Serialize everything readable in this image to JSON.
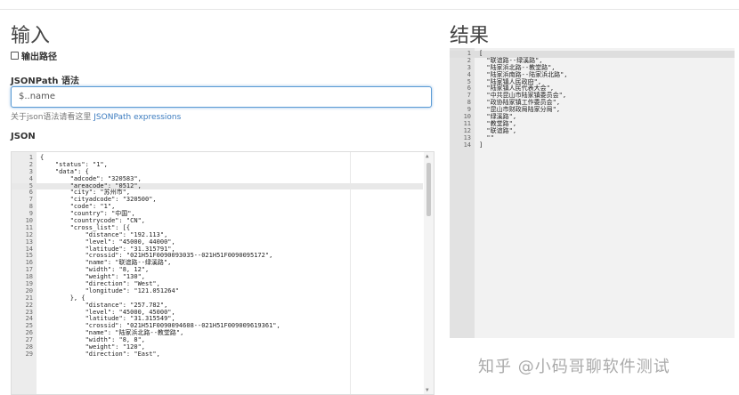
{
  "left": {
    "title": "输入",
    "output_path_label": "输出路径",
    "jsonpath_label": "JSONPath 语法",
    "jsonpath_value": "$..name",
    "help_text": "关于json语法请看这里 ",
    "help_link": "JSONPath expressions",
    "json_label": "JSON"
  },
  "editor": {
    "lines": [
      {
        "n": "1",
        "t": "{"
      },
      {
        "n": "2",
        "t": "    \"status\": \"1\","
      },
      {
        "n": "3",
        "t": "    \"data\": {"
      },
      {
        "n": "4",
        "t": "        \"adcode\": \"320583\","
      },
      {
        "n": "5",
        "t": "        \"areacode\": \"0512\","
      },
      {
        "n": "6",
        "t": "        \"city\": \"苏州市\","
      },
      {
        "n": "7",
        "t": "        \"cityadcode\": \"320500\","
      },
      {
        "n": "8",
        "t": "        \"code\": \"1\","
      },
      {
        "n": "9",
        "t": "        \"country\": \"中国\","
      },
      {
        "n": "10",
        "t": "        \"countrycode\": \"CN\","
      },
      {
        "n": "11",
        "t": "        \"cross_list\": [{"
      },
      {
        "n": "12",
        "t": "            \"distance\": \"192.113\","
      },
      {
        "n": "13",
        "t": "            \"level\": \"45000, 44000\","
      },
      {
        "n": "14",
        "t": "            \"latitude\": \"31.315791\","
      },
      {
        "n": "15",
        "t": "            \"crossid\": \"021H51F0090093035--021H51F0090095172\","
      },
      {
        "n": "16",
        "t": "            \"name\": \"联谊路--绿溪路\","
      },
      {
        "n": "17",
        "t": "            \"width\": \"8, 12\","
      },
      {
        "n": "18",
        "t": "            \"weight\": \"130\","
      },
      {
        "n": "19",
        "t": "            \"direction\": \"West\","
      },
      {
        "n": "20",
        "t": "            \"longitude\": \"121.051264\""
      },
      {
        "n": "21",
        "t": "        }, {"
      },
      {
        "n": "22",
        "t": "            \"distance\": \"257.782\","
      },
      {
        "n": "23",
        "t": "            \"level\": \"45000, 45000\","
      },
      {
        "n": "24",
        "t": "            \"latitude\": \"31.315549\","
      },
      {
        "n": "25",
        "t": "            \"crossid\": \"021H51F0090094608--021H51F009009619361\","
      },
      {
        "n": "26",
        "t": "            \"name\": \"陆家浜北路--教堂路\","
      },
      {
        "n": "27",
        "t": "            \"width\": \"8, 8\","
      },
      {
        "n": "28",
        "t": "            \"weight\": \"120\","
      },
      {
        "n": "29",
        "t": "            \"direction\": \"East\","
      }
    ]
  },
  "right": {
    "title": "结果",
    "lines": [
      {
        "n": "1",
        "t": "["
      },
      {
        "n": "2",
        "t": "  \"联谊路--绿溪路\","
      },
      {
        "n": "3",
        "t": "  \"陆家浜北路--教堂路\","
      },
      {
        "n": "4",
        "t": "  \"陆家浜南路--陆家浜北路\","
      },
      {
        "n": "5",
        "t": "  \"陆家镇人民政府\","
      },
      {
        "n": "6",
        "t": "  \"陆家镇人民代表大会\","
      },
      {
        "n": "7",
        "t": "  \"中共昆山市陆家镇委员会\","
      },
      {
        "n": "8",
        "t": "  \"政协陆家镇工作委员会\","
      },
      {
        "n": "9",
        "t": "  \"昆山市财政局陆家分局\","
      },
      {
        "n": "10",
        "t": "  \"绿溪路\","
      },
      {
        "n": "11",
        "t": "  \"教堂路\","
      },
      {
        "n": "12",
        "t": "  \"联谊路\","
      },
      {
        "n": "13",
        "t": "  \"\""
      },
      {
        "n": "14",
        "t": "]"
      }
    ]
  },
  "watermark": "知乎 @小码哥聊软件测试"
}
